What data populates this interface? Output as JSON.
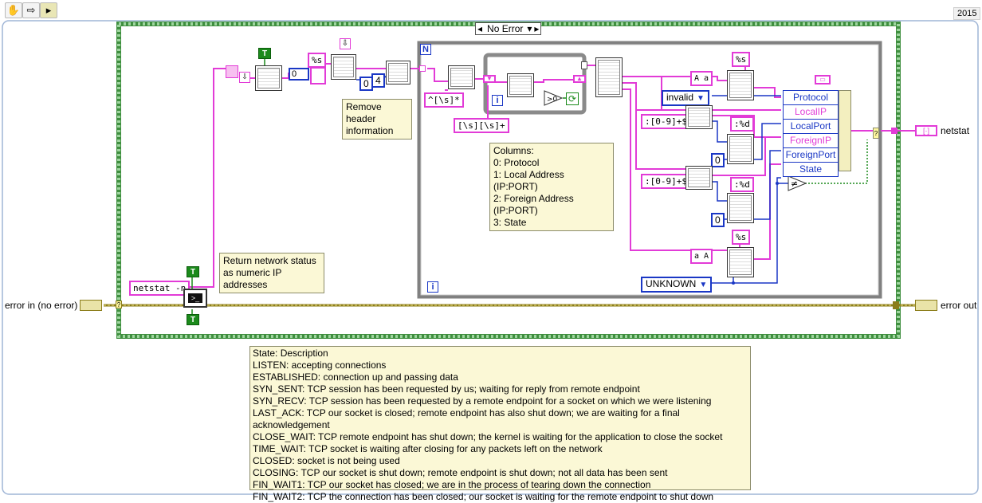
{
  "toolbar": {
    "icons": [
      "hand-icon",
      "arrow-right-icon",
      "run-vi-icon"
    ],
    "version": "2015"
  },
  "case_structure": {
    "selector": "No Error"
  },
  "for_loop": {
    "count_terminal": "N",
    "iteration_terminal": "i"
  },
  "inner_while_loop": {
    "iteration_terminal": "i"
  },
  "constants": {
    "command": "netstat -n",
    "format_s_1": "%s",
    "zero_1": "0",
    "zero_2": "0",
    "four": "4",
    "regex_1": "^[\\s]*",
    "regex_2": "[\\s][\\s]+",
    "regex_port_1": ":[0-9]+$",
    "regex_port_2": ":[0-9]+$",
    "format_s_2": "%s",
    "format_d_1": ":%d",
    "format_d_2": ":%d",
    "format_s_3": "%s",
    "zero_3": "0",
    "zero_4": "0",
    "invalid_enum": "invalid",
    "unknown_enum": "UNKNOWN",
    "case_upper": "A a",
    "case_lower": "a A",
    "true_1": "T",
    "true_2": "T",
    "true_3": "T"
  },
  "bundle_fields": [
    "Protocol",
    "LocalIP",
    "LocalPort",
    "ForeignIP",
    "ForeignPort",
    "State"
  ],
  "terminals": {
    "error_in": "error in (no error)",
    "error_out": "error out",
    "netstat": "netstat"
  },
  "comments": {
    "remove_header": "Remove header information",
    "return_status": "Return network status as numeric IP addresses",
    "columns": [
      "Columns:",
      "0: Protocol",
      "1: Local Address (IP:PORT)",
      "2: Foreign Address (IP:PORT)",
      "3: State"
    ],
    "states": [
      "State: Description",
      "LISTEN: accepting connections",
      "ESTABLISHED: connection up and passing data",
      "SYN_SENT: TCP session has been requested by us; waiting for reply from remote endpoint",
      "SYN_RECV: TCP session has been requested by a remote endpoint for a socket on which we were listening",
      "LAST_ACK: TCP our socket is closed; remote endpoint has also shut down; we are waiting for a final acknowledgement",
      "CLOSE_WAIT: TCP remote endpoint has shut down; the kernel is waiting for the application to close the socket",
      "TIME_WAIT: TCP socket is waiting after closing for any packets left on the network",
      "CLOSED: socket is not being used",
      "CLOSING: TCP our socket is shut down; remote endpoint is shut down; not all data has been sent",
      "FIN_WAIT1: TCP our socket has closed; we are in the process of tearing down the connection",
      "FIN_WAIT2: TCP the connection has been closed; our socket is waiting for the remote endpoint to shut down"
    ]
  },
  "colors": {
    "string_wire": "#e23bd7",
    "integer_wire": "#1a37c5",
    "boolean_wire": "#1b8a1b",
    "error_wire": "#8b7d1a",
    "case_border": "#5fa85f",
    "note_bg": "#fbf8d6"
  }
}
